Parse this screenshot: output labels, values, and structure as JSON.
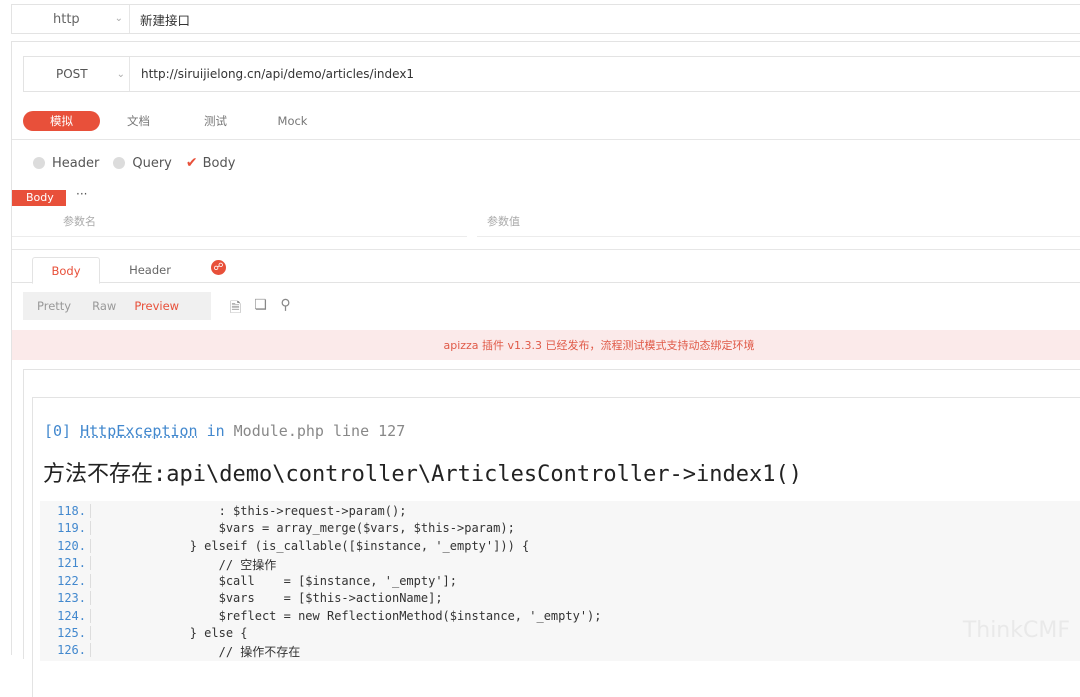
{
  "top": {
    "protocol": "http",
    "name": "新建接口"
  },
  "request": {
    "method": "POST",
    "url": "http://siruijielong.cn/api/demo/articles/index1"
  },
  "mode_tabs": [
    "模拟",
    "文档",
    "测试",
    "Mock"
  ],
  "param_types": [
    "Header",
    "Query",
    "Body"
  ],
  "body_section": {
    "tag": "Body",
    "more": "···",
    "col_name": "参数名",
    "col_value": "参数值"
  },
  "response_tabs": {
    "body": "Body",
    "header": "Header"
  },
  "view_tabs": [
    "Pretty",
    "Raw",
    "Preview"
  ],
  "notice": "apizza 插件 v1.3.3 已经发布，流程测试模式支持动态绑定环境",
  "error": {
    "index": "[0]",
    "class": "HttpException",
    "in_word": "in",
    "file": "Module.php",
    "line_word": "line",
    "line": "127",
    "message": "方法不存在:api\\demo\\controller\\ArticlesController->index1()"
  },
  "code_lines": [
    {
      "n": "118.",
      "src": "                : $this->request->param();"
    },
    {
      "n": "119.",
      "src": "                $vars = array_merge($vars, $this->param);"
    },
    {
      "n": "120.",
      "src": "            } elseif (is_callable([$instance, '_empty'])) {"
    },
    {
      "n": "121.",
      "src": "                // 空操作"
    },
    {
      "n": "122.",
      "src": "                $call    = [$instance, '_empty'];"
    },
    {
      "n": "123.",
      "src": "                $vars    = [$this->actionName];"
    },
    {
      "n": "124.",
      "src": "                $reflect = new ReflectionMethod($instance, '_empty');"
    },
    {
      "n": "125.",
      "src": "            } else {"
    },
    {
      "n": "126.",
      "src": "                // 操作不存在"
    }
  ],
  "watermark": "ThinkCMF",
  "colors": {
    "accent": "#e8503a",
    "link": "#4288ce",
    "notice_bg": "#fbeaea"
  }
}
